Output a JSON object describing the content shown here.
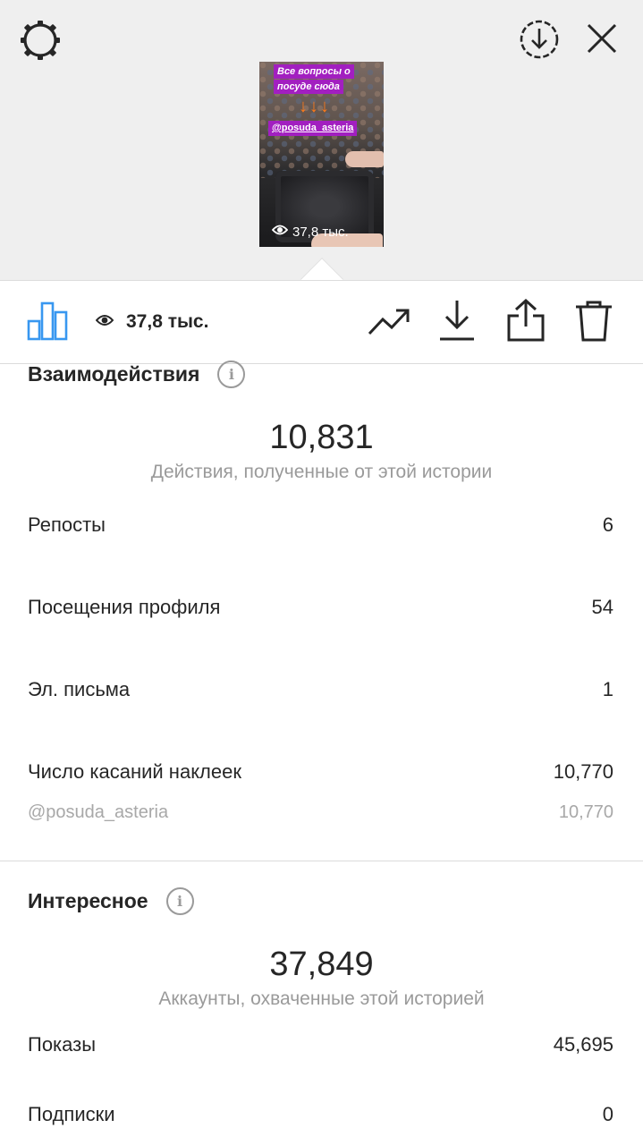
{
  "story_preview": {
    "caption_line1": "Все вопросы о",
    "caption_line2": "посуде сюда",
    "arrows": "↓↓↓",
    "tag": "@posuda_asteria",
    "views": "37,8 тыс."
  },
  "toolbar": {
    "views": "37,8 тыс."
  },
  "interactions": {
    "title": "Взаимодействия",
    "total": "10,831",
    "total_caption": "Действия, полученные от этой истории",
    "rows": [
      {
        "label": "Репосты",
        "value": "6"
      },
      {
        "label": "Посещения профиля",
        "value": "54"
      },
      {
        "label": "Эл. письма",
        "value": "1"
      },
      {
        "label": "Число касаний наклеек",
        "value": "10,770"
      }
    ],
    "sub_row": {
      "label": "@posuda_asteria",
      "value": "10,770"
    }
  },
  "discovery": {
    "title": "Интересное",
    "total": "37,849",
    "total_caption": "Аккаунты, охваченные этой историей",
    "rows": [
      {
        "label": "Показы",
        "value": "45,695"
      },
      {
        "label": "Подписки",
        "value": "0"
      }
    ]
  },
  "colors": {
    "accent": "#3897f0",
    "text": "#262626",
    "muted": "#9a9a9a",
    "header_bg": "#efefef"
  },
  "icons": {
    "settings": "gear-icon",
    "download_story": "circle-download-icon",
    "close": "close-icon",
    "insights": "bar-chart-icon",
    "eye": "eye-icon",
    "promote": "trending-up-icon",
    "save": "download-icon",
    "share": "share-icon",
    "delete": "trash-icon",
    "info": "info-icon"
  }
}
